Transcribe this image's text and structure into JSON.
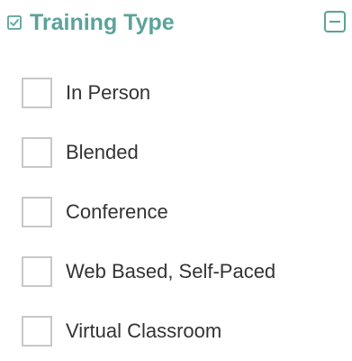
{
  "filter": {
    "title": "Training Type",
    "accent_color": "#5aa39a",
    "header_icon": "checkbox-checked-icon",
    "collapse_icon": "minus-square-icon",
    "options": [
      {
        "label": "In Person",
        "checked": false
      },
      {
        "label": "Blended",
        "checked": false
      },
      {
        "label": "Conference",
        "checked": false
      },
      {
        "label": "Web Based, Self-Paced",
        "checked": false
      },
      {
        "label": "Virtual Classroom",
        "checked": false
      }
    ]
  }
}
